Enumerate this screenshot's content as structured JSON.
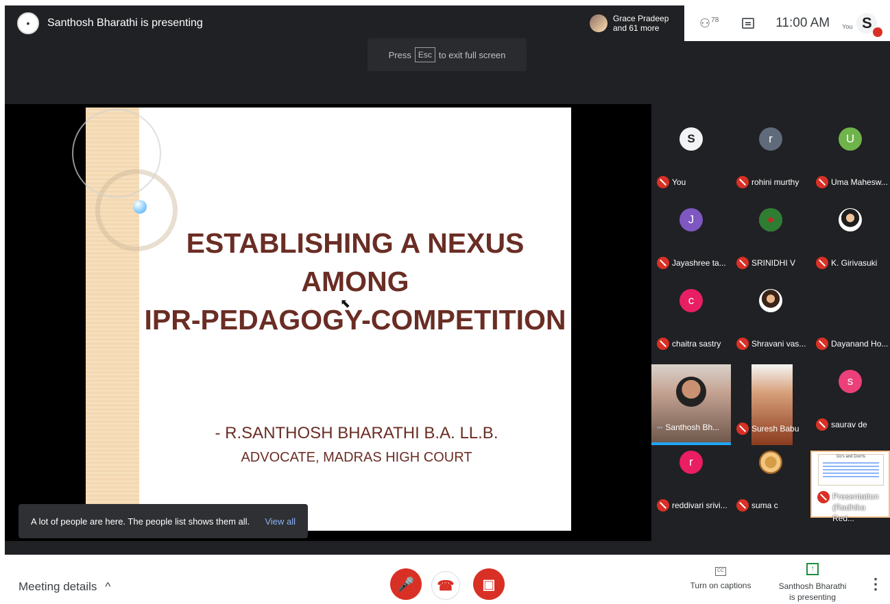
{
  "header": {
    "presenting_text": "Santhosh Bharathi is presenting",
    "esc_hint": [
      "Press",
      "Esc",
      "to exit full screen"
    ],
    "others_name": "Grace Pradeep",
    "others_more": "and 61 more",
    "participants_count": "78",
    "time": "11:00 AM",
    "you_label": "You"
  },
  "slide": {
    "title_line1": "ESTABLISHING A NEXUS",
    "title_line2": "AMONG",
    "title_line3": "IPR-PEDAGOGY-COMPETITION",
    "author": "- R.SANTHOSH BHARATHI  B.A. LL.B.",
    "court": "ADVOCATE, MADRAS HIGH COURT"
  },
  "toast": {
    "message": "A lot of people are here. The people list shows them all.",
    "action": "View all"
  },
  "participants": [
    {
      "name": "You",
      "initial": "S",
      "color": "#f1f3f4"
    },
    {
      "name": "rohini murthy",
      "initial": "r",
      "color": "#5f6b7a"
    },
    {
      "name": "Uma Mahesw...",
      "initial": "U",
      "color": "#6fb34b"
    },
    {
      "name": "Jayashree ta...",
      "initial": "J",
      "color": "#7e57c2"
    },
    {
      "name": "SRINIDHI V",
      "initial": "",
      "color": "#33691e"
    },
    {
      "name": "K. Girivasuki",
      "initial": "",
      "color": "#f5f5f5"
    },
    {
      "name": "chaitra sastry",
      "initial": "c",
      "color": "#e91e63"
    },
    {
      "name": "Shravani vas...",
      "initial": "",
      "color": "#f5f5f5"
    },
    {
      "name": "Dayanand Ho...",
      "initial": "",
      "color": "#202124"
    },
    {
      "name": "Santhosh Bh...",
      "initial": "",
      "color": "#c4a292"
    },
    {
      "name": "Suresh Babu",
      "initial": "",
      "color": "#b65c32"
    },
    {
      "name": "saurav de",
      "initial": "s",
      "color": "#ec407a"
    },
    {
      "name": "reddivari srivi...",
      "initial": "r",
      "color": "#e91e63"
    },
    {
      "name": "suma c",
      "initial": "",
      "color": "#c98a35"
    },
    {
      "name": "Presentation\n(Radhika Red...",
      "initial": "",
      "color": "#f8f3e7"
    }
  ],
  "thumb": {
    "title": "Do's and Don'ts"
  },
  "bottom": {
    "meeting_details": "Meeting details",
    "chevron": "^",
    "captions": "Turn on captions",
    "cc_label": "CC",
    "presenting_line1": "Santhosh Bharathi",
    "presenting_line2": "is presenting",
    "more": "⋮"
  },
  "colors": {
    "accent_red": "#d93025",
    "title_brown": "#6a2d24",
    "meet_dark": "#202124"
  }
}
